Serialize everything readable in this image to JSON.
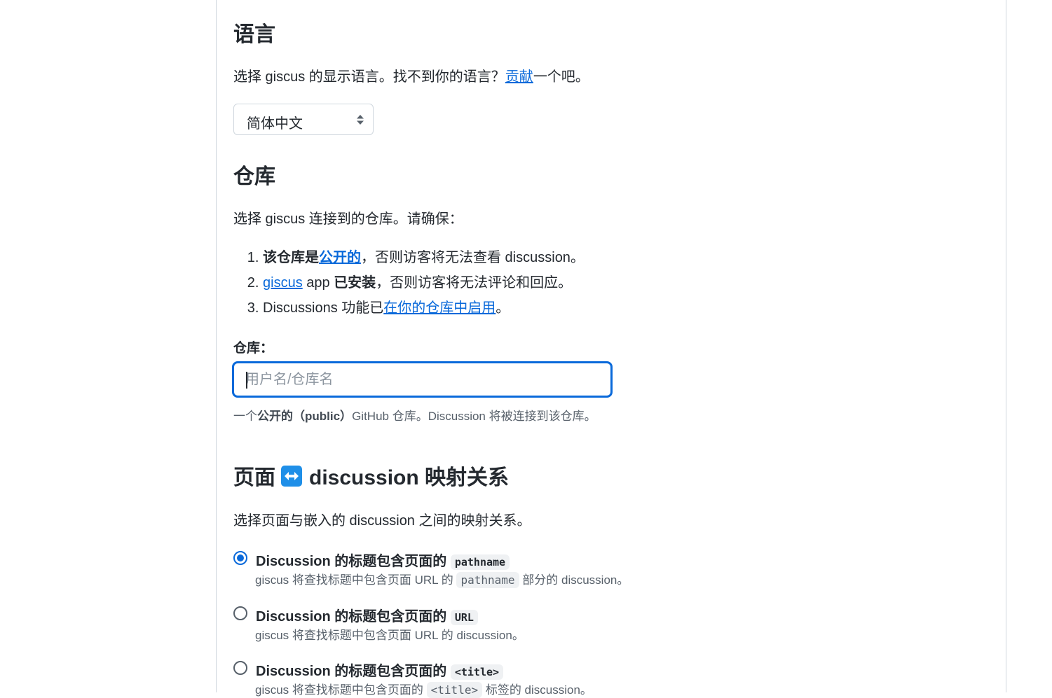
{
  "language": {
    "heading": "语言",
    "desc_before": "选择 giscus 的显示语言。找不到你的语言？",
    "desc_link": "贡献",
    "desc_after": "一个吧。",
    "select_value": "简体中文"
  },
  "repository": {
    "heading": "仓库",
    "desc": "选择 giscus 连接到的仓库。请确保：",
    "req1_bold": "该仓库是",
    "req1_link": "公开的",
    "req1_rest": "，否则访客将无法查看 discussion。",
    "req2_link": "giscus",
    "req2_mid": " app ",
    "req2_bold": "已安装",
    "req2_rest": "，否则访客将无法评论和回应。",
    "req3_text": "Discussions 功能已",
    "req3_link": "在你的仓库中启用",
    "req3_end": "。",
    "field_label": "仓库：",
    "input_placeholder": "用户名/仓库名",
    "input_value": "",
    "hint_before": "一个",
    "hint_bold": "公开的（public）",
    "hint_after": "GitHub 仓库。Discussion 将被连接到该仓库。"
  },
  "mapping": {
    "heading_before": "页面",
    "heading_after": "discussion 映射关系",
    "arrow_icon": "left-right-arrow-icon",
    "desc": "选择页面与嵌入的 discussion 之间的映射关系。",
    "options": [
      {
        "selected": true,
        "title": "Discussion 的标题包含页面的",
        "code": "pathname",
        "desc_before": "giscus 将查找标题中包含页面 URL 的",
        "desc_code": "pathname",
        "desc_after": "部分的 discussion。"
      },
      {
        "selected": false,
        "title": "Discussion 的标题包含页面的",
        "code": "URL",
        "desc_before": "giscus 将查找标题中包含页面 URL 的 discussion。"
      },
      {
        "selected": false,
        "title": "Discussion 的标题包含页面的",
        "code": "<title>",
        "desc_before": "giscus 将查找标题中包含页面的",
        "desc_code": "<title>",
        "desc_after": "标签的 discussion。"
      }
    ]
  },
  "colors": {
    "accent": "#0969da",
    "text": "#24292f",
    "muted": "#57606a",
    "border": "#d0d7de"
  }
}
